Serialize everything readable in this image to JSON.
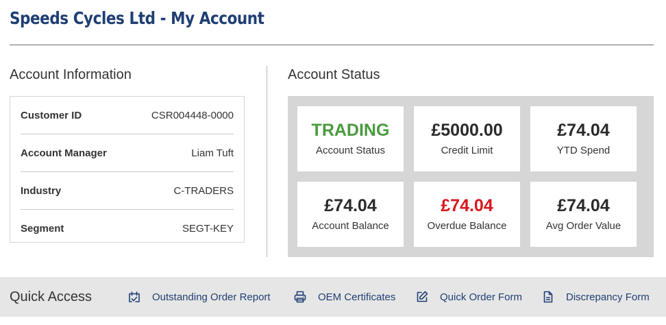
{
  "header": {
    "title": "Speeds Cycles Ltd - My Account"
  },
  "account_information": {
    "heading": "Account Information",
    "rows": [
      {
        "label": "Customer ID",
        "value": "CSR004448-0000"
      },
      {
        "label": "Account Manager",
        "value": "Liam Tuft"
      },
      {
        "label": "Industry",
        "value": "C-TRADERS"
      },
      {
        "label": "Segment",
        "value": "SEGT-KEY"
      }
    ]
  },
  "account_status": {
    "heading": "Account Status",
    "cards": [
      {
        "value": "TRADING",
        "label": "Account Status",
        "color": "#4a9a3e"
      },
      {
        "value": "£5000.00",
        "label": "Credit Limit",
        "color": "#2a2a2a"
      },
      {
        "value": "£74.04",
        "label": "YTD Spend",
        "color": "#2a2a2a"
      },
      {
        "value": "£74.04",
        "label": "Account Balance",
        "color": "#2a2a2a"
      },
      {
        "value": "£74.04",
        "label": "Overdue Balance",
        "color": "#d8161c"
      },
      {
        "value": "£74.04",
        "label": "Avg Order Value",
        "color": "#2a2a2a"
      }
    ]
  },
  "quick_access": {
    "title": "Quick Access",
    "links": [
      {
        "label": "Outstanding Order Report",
        "icon": "calendar-check-icon"
      },
      {
        "label": "OEM Certificates",
        "icon": "printer-icon"
      },
      {
        "label": "Quick Order Form",
        "icon": "edit-icon"
      },
      {
        "label": "Discrepancy Form",
        "icon": "document-icon"
      }
    ]
  },
  "colors": {
    "brand_navy": "#1f3f73",
    "status_green": "#4a9a3e",
    "overdue_red": "#d8161c",
    "panel_grey": "#d6d6d6",
    "bar_grey": "#e6e6e6"
  }
}
